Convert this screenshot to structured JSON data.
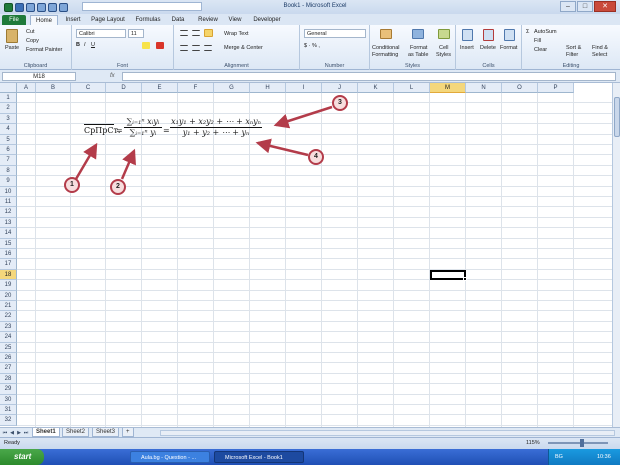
{
  "window": {
    "title": "Book1 - Microsoft Excel",
    "minimize": "–",
    "maximize": "□",
    "close": "✕"
  },
  "ribbon_tabs": [
    "File",
    "Home",
    "Insert",
    "Page Layout",
    "Formulas",
    "Data",
    "Review",
    "View",
    "Developer"
  ],
  "ribbon": {
    "clipboard": {
      "paste": "Paste",
      "cut": "Cut",
      "copy": "Copy",
      "format_painter": "Format Painter",
      "label": "Clipboard"
    },
    "font": {
      "family": "Calibri",
      "size": "11",
      "label": "Font"
    },
    "alignment": {
      "wrap_text": "Wrap Text",
      "merge_center": "Merge & Center",
      "label": "Alignment"
    },
    "number": {
      "format": "General",
      "label": "Number"
    },
    "styles": {
      "conditional": "Conditional",
      "formatting": "Formatting",
      "format_as": "Format",
      "as_table": "as Table",
      "cell": "Cell",
      "styles_btn": "Styles",
      "label": "Styles"
    },
    "cells": {
      "insert": "Insert",
      "delete": "Delete",
      "format": "Format",
      "label": "Cells"
    },
    "editing": {
      "autosum": "AutoSum",
      "fill": "Fill",
      "clear": "Clear",
      "sort": "Sort &",
      "filter": "Filter",
      "find": "Find &",
      "select": "Select",
      "label": "Editing"
    }
  },
  "formula_bar": {
    "name_box": "M18",
    "fx": "fx",
    "value": ""
  },
  "grid": {
    "columns": [
      "A",
      "B",
      "C",
      "D",
      "E",
      "F",
      "G",
      "H",
      "I",
      "J",
      "K",
      "L",
      "M",
      "N",
      "O",
      "P"
    ],
    "rows": [
      "1",
      "2",
      "3",
      "4",
      "5",
      "6",
      "7",
      "8",
      "9",
      "10",
      "11",
      "12",
      "13",
      "14",
      "15",
      "16",
      "17",
      "18",
      "19",
      "20",
      "21",
      "22",
      "23",
      "24",
      "25",
      "26",
      "27",
      "28",
      "29",
      "30",
      "31",
      "32"
    ],
    "selected_column": "M",
    "selected_row": "18"
  },
  "equation": {
    "lhs": "СрПрСт.",
    "eq1": "=",
    "sum_num": "∑ᵢ₌₁ⁿ xᵢyᵢ",
    "sum_den": "∑ᵢ₌₁ⁿ yᵢ",
    "eq2": "=",
    "exp_num": "x₁y₁ + x₂y₂ + ⋯ + xₙyₙ",
    "exp_den": "y₁ + y₂ + ⋯ + yₙ"
  },
  "callouts": [
    "1",
    "2",
    "3",
    "4"
  ],
  "callout_color": "#b33c4a",
  "sheets": {
    "tabs": [
      "Sheet1",
      "Sheet2",
      "Sheet3"
    ],
    "active": "Sheet1"
  },
  "status": {
    "ready": "Ready",
    "zoom": "115%"
  },
  "taskbar": {
    "start": "start",
    "tasks": [
      "Aula.bg - Question - ...",
      "Microsoft Excel - Book1"
    ],
    "lang": "BG",
    "time": "10:36"
  }
}
